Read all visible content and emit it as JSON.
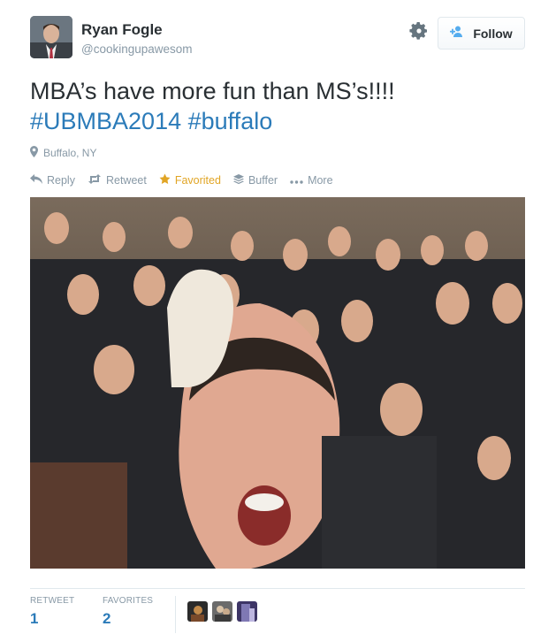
{
  "user": {
    "name": "Ryan Fogle",
    "handle": "@cookingupawesom"
  },
  "follow_button": {
    "label": "Follow",
    "icon": "add-user-icon"
  },
  "tweet": {
    "text_line1": "MBA’s have more fun than MS’s!!!!",
    "hashtags": [
      "#UBMBA2014",
      "#buffalo"
    ]
  },
  "location": {
    "text": "Buffalo, NY",
    "icon": "map-pin-icon"
  },
  "actions": {
    "reply": "Reply",
    "retweet": "Retweet",
    "favorited": "Favorited",
    "buffer": "Buffer",
    "more": "More"
  },
  "stats": {
    "retweets_label": "RETWEET",
    "retweets_value": "1",
    "favorites_label": "FAVORITES",
    "favorites_value": "2"
  },
  "colors": {
    "link": "#2b7bb9",
    "muted": "#8899a6",
    "favorited": "#e1a525",
    "text": "#292f33"
  }
}
